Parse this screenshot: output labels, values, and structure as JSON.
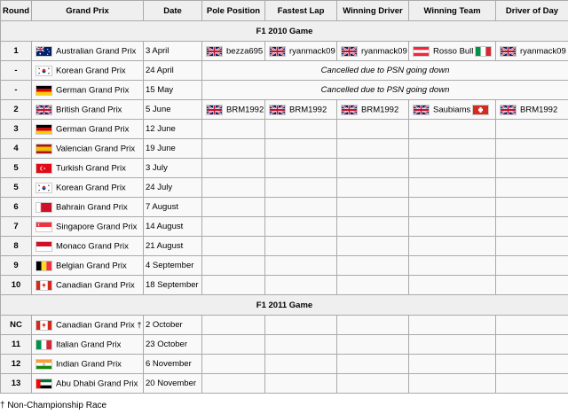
{
  "headers": [
    "Round",
    "Grand Prix",
    "Date",
    "Pole Position",
    "Fastest Lap",
    "Winning Driver",
    "Winning Team",
    "Driver of Day"
  ],
  "section1": "F1 2010 Game",
  "section2": "F1 2011 Game",
  "rows2010": [
    {
      "round": "1",
      "flag": "au",
      "gp": "Australian Grand Prix",
      "date": "3 April",
      "pole": "bezza695",
      "fast": "ryanmack09",
      "win": "ryanmack09",
      "team": "Rosso Bull",
      "dod": "ryanmack09"
    },
    {
      "round": "-",
      "flag": "kr",
      "gp": "Korean Grand Prix",
      "date": "24 April",
      "note": "Cancelled due to PSN going down"
    },
    {
      "round": "-",
      "flag": "de",
      "gp": "German Grand Prix",
      "date": "15 May",
      "note": "Cancelled due to PSN going down"
    },
    {
      "round": "2",
      "flag": "gb",
      "gp": "British Grand Prix",
      "date": "5 June",
      "pole": "BRM1992",
      "fast": "BRM1992",
      "win": "BRM1992",
      "team": "Saubiams",
      "dod": "BRM1992"
    },
    {
      "round": "3",
      "flag": "de",
      "gp": "German Grand Prix",
      "date": "12 June"
    },
    {
      "round": "4",
      "flag": "es",
      "gp": "Valencian Grand Prix",
      "date": "19 June"
    },
    {
      "round": "5",
      "flag": "tr",
      "gp": "Turkish Grand Prix",
      "date": "3 July"
    },
    {
      "round": "5",
      "flag": "kr",
      "gp": "Korean Grand Prix",
      "date": "24 July"
    },
    {
      "round": "6",
      "flag": "bh",
      "gp": "Bahrain Grand Prix",
      "date": "7 August"
    },
    {
      "round": "7",
      "flag": "sg",
      "gp": "Singapore Grand Prix",
      "date": "14 August"
    },
    {
      "round": "8",
      "flag": "mc",
      "gp": "Monaco Grand Prix",
      "date": "21 August"
    },
    {
      "round": "9",
      "flag": "be",
      "gp": "Belgian Grand Prix",
      "date": "4 September"
    },
    {
      "round": "10",
      "flag": "ca",
      "gp": "Canadian Grand Prix",
      "date": "18 September"
    }
  ],
  "rows2011": [
    {
      "round": "NC",
      "flag": "ca",
      "gp": "Canadian Grand Prix †",
      "date": "2 October"
    },
    {
      "round": "11",
      "flag": "it",
      "gp": "Italian Grand Prix",
      "date": "23 October"
    },
    {
      "round": "12",
      "flag": "in",
      "gp": "Indian Grand Prix",
      "date": "6 November"
    },
    {
      "round": "13",
      "flag": "ae",
      "gp": "Abu Dhabi Grand Prix",
      "date": "20 November"
    }
  ],
  "team_flags": {
    "Rosso Bull": "it",
    "Saubiams": "ch"
  },
  "driver_flags": {
    "pole": "gb",
    "fast": "gb",
    "win": "gb",
    "dod": "gb"
  },
  "pole_flag_row1": "gb",
  "footnote": "† Non-Championship Race",
  "colors": {
    "header_bg": "#efefef",
    "cell_bg": "#f9f9f9",
    "border": "#aaaaaa"
  }
}
